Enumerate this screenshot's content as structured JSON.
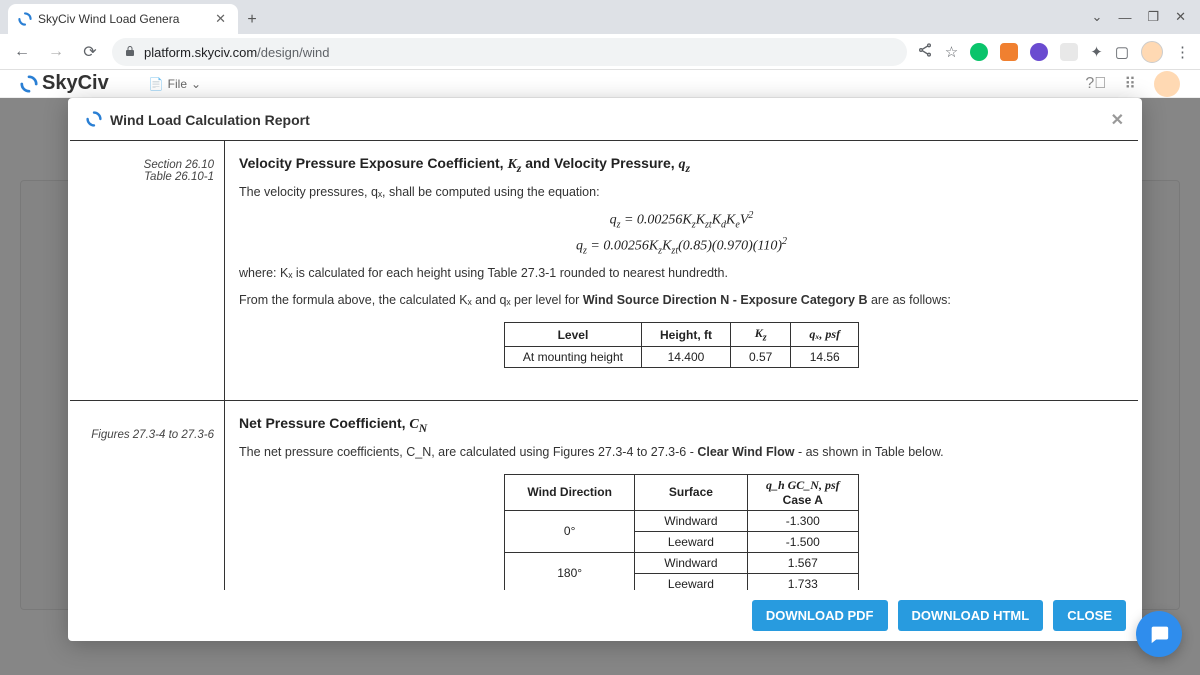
{
  "browser": {
    "tab_title": "SkyCiv Wind Load Genera",
    "url_host": "platform.skyciv.com",
    "url_path": "/design/wind"
  },
  "app": {
    "brand": "SkyCiv",
    "file_menu": "File"
  },
  "modal": {
    "title": "Wind Load Calculation Report",
    "buttons": {
      "pdf": "DOWNLOAD PDF",
      "html": "DOWNLOAD HTML",
      "close": "CLOSE"
    }
  },
  "section1": {
    "ref_line1": "Section 26.10",
    "ref_line2": "Table 26.10-1",
    "title_prefix": "Velocity Pressure Exposure Coefficient, ",
    "title_sym1": "K",
    "title_mid": " and Velocity Pressure, ",
    "title_sym2": "q",
    "intro": "The velocity pressures, qₓ, shall be computed using the equation:",
    "eq1": "qₓ = 0.00256 Kₓ Kₓₜ K_d K_e V²",
    "eq2": "qₓ = 0.00256 Kₓ Kₓₜ (0.85)(0.970)(110)²",
    "where": "where: Kₓ is calculated for each height using Table 27.3-1 rounded to nearest hundredth.",
    "from_formula_pre": "From the formula above, the calculated Kₓ and qₓ per level for ",
    "from_formula_bold": "Wind Source Direction N - Exposure Category B",
    "from_formula_post": " are as follows:",
    "table": {
      "h1": "Level",
      "h2": "Height, ft",
      "h3": "K",
      "h4": "qₓ, psf",
      "r1c1": "At mounting height",
      "r1c2": "14.400",
      "r1c3": "0.57",
      "r1c4": "14.56"
    }
  },
  "section2": {
    "ref": "Figures 27.3-4 to 27.3-6",
    "title_prefix": "Net Pressure Coefficient, ",
    "title_sym": "C",
    "intro_pre": "The net pressure coefficients, C_N, are calculated using Figures 27.3-4 to 27.3-6 - ",
    "intro_bold": "Clear Wind Flow",
    "intro_post": " - as shown in Table below.",
    "table": {
      "h1": "Wind Direction",
      "h2": "Surface",
      "h3_top": "q_h GC_N, psf",
      "h3_bot": "Case A",
      "rows": [
        {
          "dir": "0°",
          "surf": "Windward",
          "val": "-1.300"
        },
        {
          "dir": "",
          "surf": "Leeward",
          "val": "-1.500"
        },
        {
          "dir": "180°",
          "surf": "Windward",
          "val": "1.567"
        },
        {
          "dir": "",
          "surf": "Leeward",
          "val": "1.733"
        }
      ]
    }
  }
}
